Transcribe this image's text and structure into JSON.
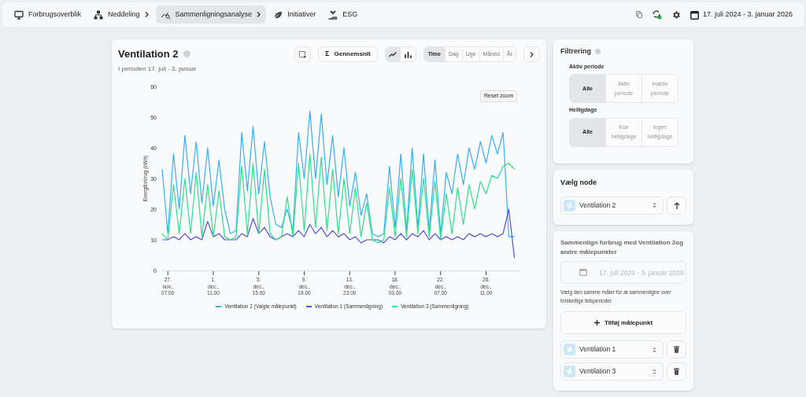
{
  "nav": {
    "items": [
      {
        "label": "Forbrugsoverblik",
        "caret": false,
        "selected": false
      },
      {
        "label": "Neddeling",
        "caret": true,
        "selected": false
      },
      {
        "label": "Sammenligningsanalyse",
        "caret": true,
        "selected": true
      },
      {
        "label": "Initiativer",
        "caret": false,
        "selected": false
      },
      {
        "label": "ESG",
        "caret": false,
        "selected": false
      }
    ],
    "date_range": "17. juli 2024 - 3. januar 2026"
  },
  "chart_card": {
    "title": "Ventilation 2",
    "subtitle": "I perioden 17. juli - 3. januar",
    "average_icon": "Σ",
    "average_button": "Gennemsnit",
    "chart_types": [
      {
        "kind": "line",
        "selected": true
      },
      {
        "kind": "bar",
        "selected": false
      }
    ],
    "periods": [
      {
        "label": "Time",
        "selected": true
      },
      {
        "label": "Dag",
        "selected": false
      },
      {
        "label": "Uge",
        "selected": false
      },
      {
        "label": "Måned",
        "selected": false
      },
      {
        "label": "År",
        "selected": false
      }
    ],
    "reset_zoom": "Reset zoom",
    "chart_data": {
      "type": "line",
      "legend": "bottom",
      "ylabel": "Energiforbrug (kWh)",
      "ylim": [
        0,
        60
      ],
      "yticks": [
        0,
        10,
        20,
        30,
        40,
        50,
        60
      ],
      "categories": [
        null,
        "27. nov., 07.00",
        null,
        null,
        null,
        null,
        null,
        null,
        null,
        "1. dec., 11.00",
        null,
        null,
        null,
        null,
        null,
        null,
        null,
        "5. dec., 15.00",
        null,
        null,
        null,
        null,
        null,
        null,
        null,
        "9. dec., 19.00",
        null,
        null,
        null,
        null,
        null,
        null,
        null,
        "13. dec., 23.00",
        null,
        null,
        null,
        null,
        null,
        null,
        null,
        "18. dec., 03.00",
        null,
        null,
        null,
        null,
        null,
        null,
        null,
        "22. dec., 07.00",
        null,
        null,
        null,
        null,
        null,
        null,
        null,
        "26. dec., 11.00",
        null,
        null,
        null,
        null,
        null
      ],
      "series": [
        {
          "name": "Ventilation 2 (Valgte målepunkt)",
          "color": "#38aef5",
          "values": [
            33,
            12,
            38,
            20,
            44,
            25,
            42,
            22,
            40,
            21,
            36,
            20,
            12,
            13,
            45,
            26,
            47,
            25,
            42,
            24,
            15,
            14,
            20,
            13,
            45,
            30,
            52,
            30,
            51,
            28,
            44,
            24,
            40,
            21,
            32,
            18,
            25,
            12,
            11,
            12,
            34,
            14,
            38,
            13,
            40,
            14,
            38,
            13,
            36,
            12,
            32,
            25,
            38,
            28,
            40,
            33,
            42,
            35,
            44,
            38,
            45,
            11,
            11
          ]
        },
        {
          "name": "Ventilation 1 (Sammenligning)",
          "color": "#5b4fcf",
          "values": [
            10,
            10,
            11,
            10,
            12,
            10,
            11,
            10,
            16,
            11,
            12,
            10,
            10,
            10,
            12,
            11,
            17,
            12,
            14,
            11,
            10,
            11,
            12,
            11,
            13,
            11,
            15,
            12,
            14,
            11,
            13,
            11,
            12,
            10,
            11,
            9,
            10,
            10,
            10,
            9,
            11,
            10,
            12,
            10,
            12,
            11,
            13,
            10,
            12,
            10,
            11,
            10,
            11,
            10,
            12,
            11,
            12,
            11,
            12,
            11,
            12,
            20,
            4
          ]
        },
        {
          "name": "Ventilation 3 (Sammenligning)",
          "color": "#2ee08a",
          "values": [
            12,
            10,
            28,
            12,
            30,
            12,
            32,
            11,
            28,
            11,
            26,
            11,
            10,
            11,
            34,
            12,
            35,
            12,
            33,
            12,
            10,
            11,
            24,
            11,
            35,
            13,
            38,
            14,
            37,
            13,
            33,
            12,
            30,
            12,
            27,
            11,
            22,
            10,
            9,
            10,
            27,
            11,
            30,
            11,
            33,
            12,
            30,
            11,
            29,
            10,
            25,
            12,
            27,
            15,
            28,
            20,
            29,
            25,
            31,
            30,
            34,
            35,
            33
          ]
        }
      ]
    }
  },
  "filter": {
    "title": "Filtrering",
    "groups": [
      {
        "label": "Aktiv periode",
        "options": [
          {
            "label": "Alle",
            "selected": true
          },
          {
            "label": "Aktiv periode",
            "selected": false
          },
          {
            "label": "Inaktiv periode",
            "selected": false
          }
        ]
      },
      {
        "label": "Helligdage",
        "options": [
          {
            "label": "Alle",
            "selected": true
          },
          {
            "label": "Kun helligdage",
            "selected": false
          },
          {
            "label": "Ingen helligdage",
            "selected": false
          }
        ]
      }
    ]
  },
  "node": {
    "title": "Vælg node",
    "value": "Ventilation 2"
  },
  "compare": {
    "description": "Sammenlign forbrug med Ventilation 2og andre målepunkter",
    "date_placeholder": "17. juli 2024 - 3. januar 2026",
    "hint": "Vælg den samme måler for at sammenligne over forskellige tidsperioder.",
    "add_button": "Tilføj målepunkt",
    "meters": [
      {
        "label": "Ventilation 1"
      },
      {
        "label": "Ventilation 3"
      }
    ]
  }
}
